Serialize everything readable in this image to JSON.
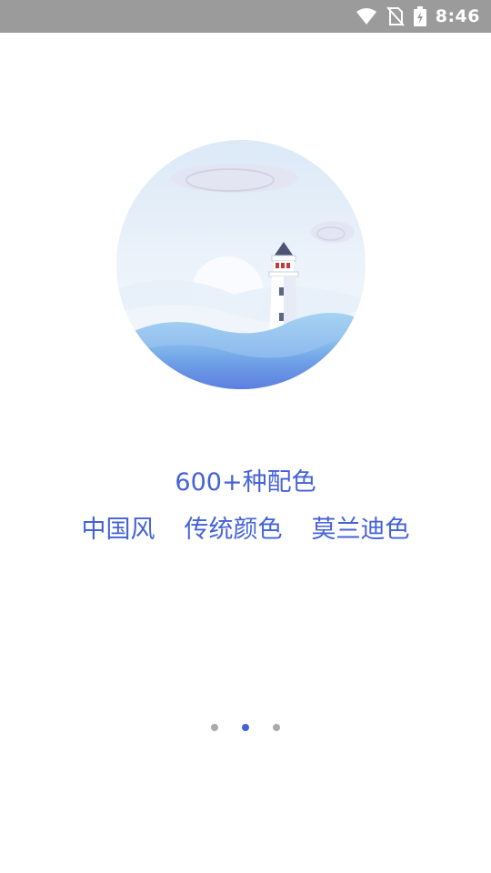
{
  "status_bar": {
    "time": "8:46",
    "icons": [
      "wifi-icon",
      "no-sim-icon",
      "battery-charging-icon"
    ]
  },
  "onboarding": {
    "illustration": "lighthouse-illustration",
    "headline": "600+种配色",
    "styles": [
      "中国风",
      "传统颜色",
      "莫兰迪色"
    ]
  },
  "pager": {
    "page_count": 3,
    "active_page": 2
  },
  "colors": {
    "status_bar_bg": "#9b9b9b",
    "accent": "#4462d8",
    "inactive_dot": "#aaaaaa"
  }
}
